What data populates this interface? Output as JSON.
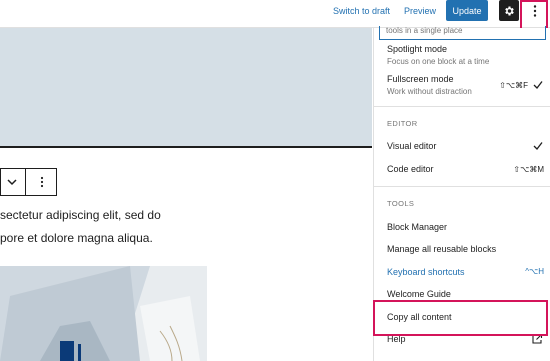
{
  "topbar": {
    "switch_to_draft": "Switch to draft",
    "preview": "Preview",
    "update": "Update",
    "settings_icon": "gear-icon",
    "options_icon": "vertical-ellipsis-icon",
    "accent_color": "#2271b1",
    "highlight_color": "#d4145a"
  },
  "editor": {
    "paragraph_line_1": "sectetur adipiscing elit, sed do",
    "paragraph_line_2": "pore et dolore magna aliqua."
  },
  "menu": {
    "search_value": "tools in a single place",
    "spotlight_mode": {
      "label": "Spotlight mode",
      "description": "Focus on one block at a time"
    },
    "fullscreen_mode": {
      "label": "Fullscreen mode",
      "description": "Work without distraction",
      "shortcut": "⇧⌥⌘F",
      "checked": true
    },
    "editor_section": {
      "title": "EDITOR",
      "visual_editor": {
        "label": "Visual editor",
        "checked": true
      },
      "code_editor": {
        "label": "Code editor",
        "shortcut": "⇧⌥⌘M"
      }
    },
    "tools_section": {
      "title": "TOOLS",
      "block_manager": "Block Manager",
      "manage_reusable": "Manage all reusable blocks",
      "keyboard_shortcuts": {
        "label": "Keyboard shortcuts",
        "shortcut": "^⌥H"
      },
      "welcome_guide": "Welcome Guide",
      "copy_all_content": "Copy all content",
      "help": "Help"
    }
  }
}
